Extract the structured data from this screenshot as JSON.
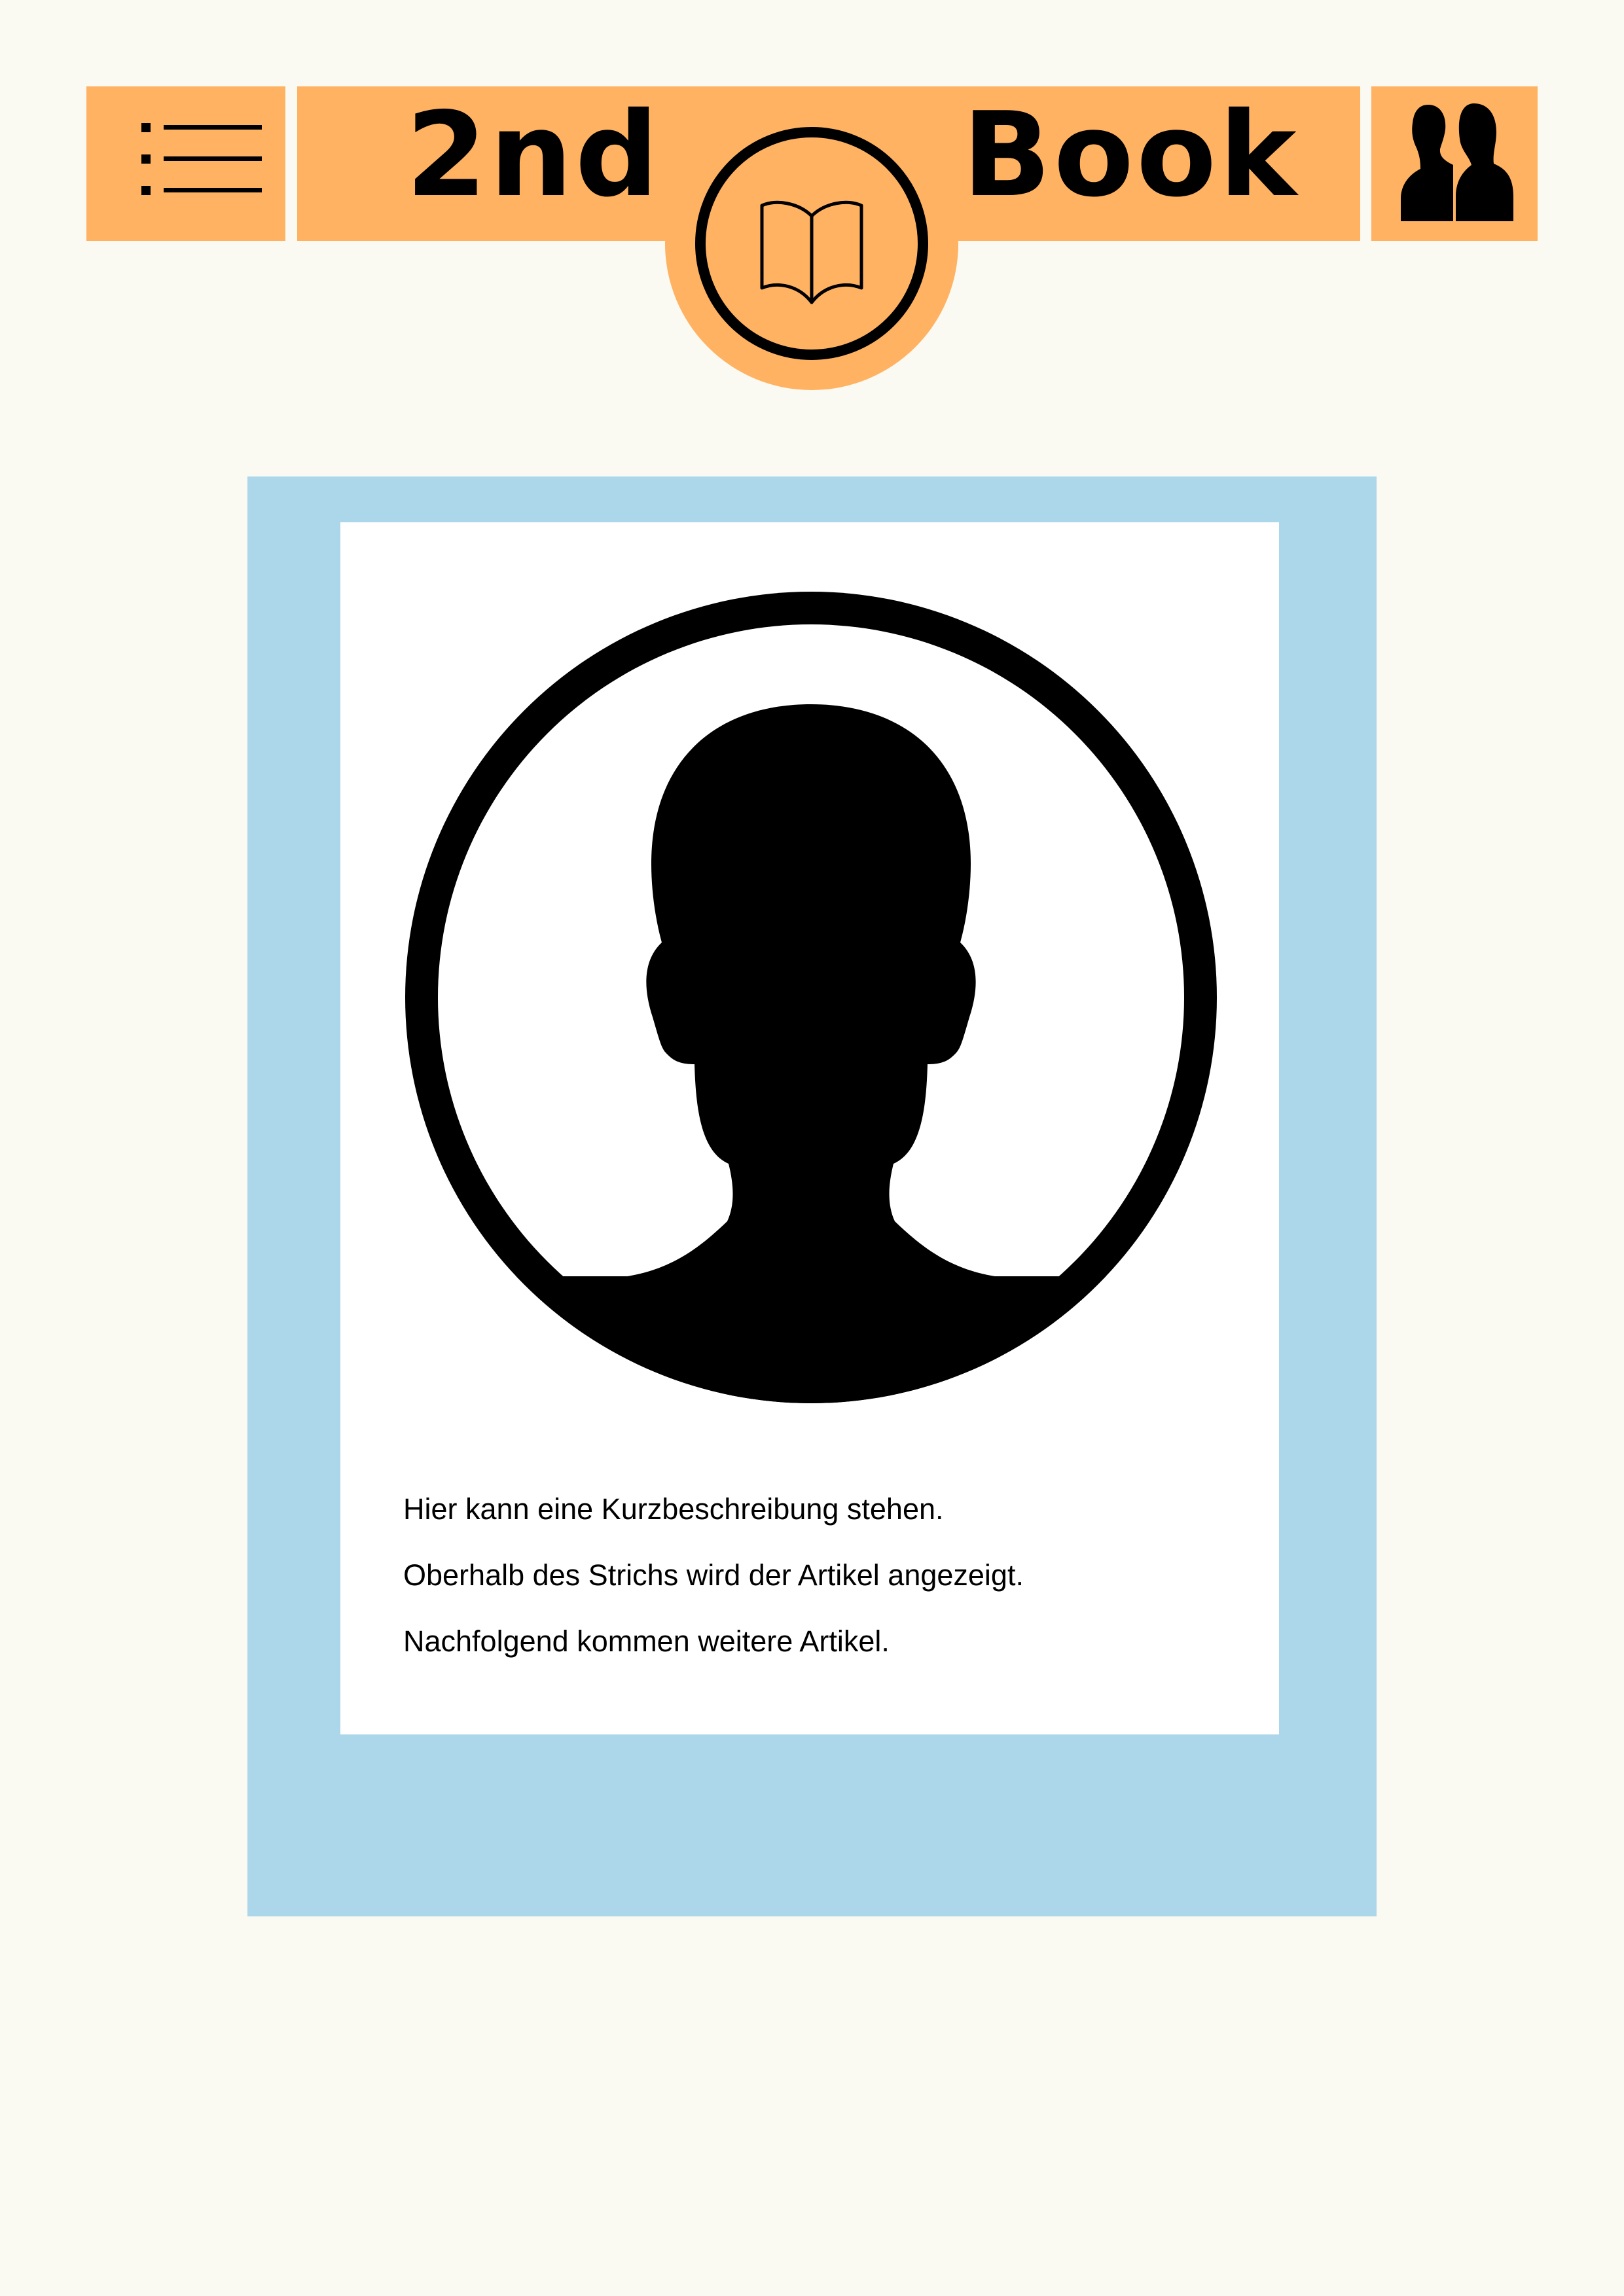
{
  "header": {
    "title_left": "2nd",
    "title_right": "Book",
    "menu_icon": "list-icon",
    "logo_icon": "open-book-icon",
    "users_icon": "users-icon"
  },
  "colors": {
    "background": "#fafaf2",
    "header_orange": "#ffb261",
    "card_blue": "#acd6ea",
    "card_white": "#ffffff",
    "ink": "#000000"
  },
  "card": {
    "avatar_icon": "user-avatar-icon",
    "lines": [
      "Hier kann eine Kurzbeschreibung stehen.",
      "Oberhalb des Strichs wird der Artikel angezeigt.",
      "Nachfolgend kommen weitere Artikel."
    ]
  }
}
